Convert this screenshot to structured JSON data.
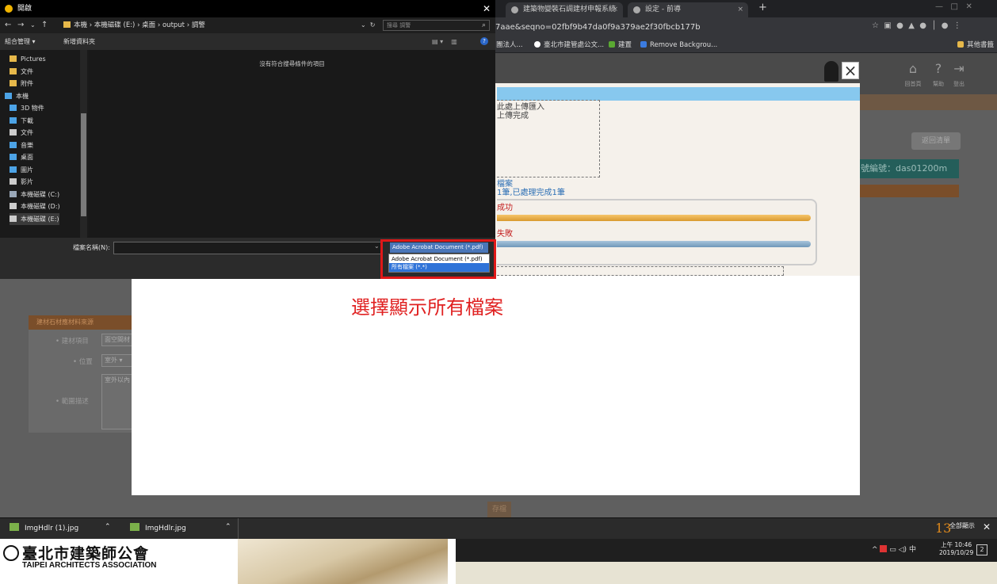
{
  "browser": {
    "tabs": [
      {
        "label": "建築物變裝石調建材申報系統"
      },
      {
        "label": "設定 - 前導"
      }
    ],
    "new_tab": "+",
    "url": "7aae&seqno=02fbf9b47da0f9a379ae2f30fbcb177b",
    "bookmarks": [
      "團法人...",
      "臺北市建管處公文...",
      "建置",
      "Remove Backgrou..."
    ],
    "other_bookmarks": "其他書籤"
  },
  "dialog": {
    "title": "開啟",
    "breadcrumb": "本機 › 本機磁碟 (E:) › 桌面 › output › 調警",
    "search_placeholder": "搜尋 調警",
    "toolbar_organize": "組合管理 ▾",
    "toolbar_newfolder": "新增資料夾",
    "tree": [
      {
        "label": "Pictures",
        "color": "#e6b84a"
      },
      {
        "label": "文件",
        "color": "#e6b84a"
      },
      {
        "label": "附件",
        "color": "#e6b84a"
      },
      {
        "label": "本機",
        "color": "#4ca3e6"
      },
      {
        "label": "3D 物件",
        "color": "#4ca3e6"
      },
      {
        "label": "下載",
        "color": "#4ca3e6"
      },
      {
        "label": "文件",
        "color": "#cccccc"
      },
      {
        "label": "音樂",
        "color": "#4ca3e6"
      },
      {
        "label": "桌面",
        "color": "#4ca3e6"
      },
      {
        "label": "圖片",
        "color": "#4ca3e6"
      },
      {
        "label": "影片",
        "color": "#cccccc"
      },
      {
        "label": "本機磁碟 (C:)",
        "color": "#9aa8b8"
      },
      {
        "label": "本機磁碟 (D:)",
        "color": "#cccccc"
      },
      {
        "label": "本機磁碟 (E:)",
        "color": "#cccccc"
      }
    ],
    "empty_message": "沒有符合搜尋條件的項目",
    "filename_label": "檔案名稱(N):",
    "filetype_selected": "Adobe Acrobat Document (*.pdf)",
    "filetype_options": [
      "Adobe Acrobat Document (*.pdf)",
      "所有檔案 (*.*)"
    ]
  },
  "modal": {
    "close": "×",
    "upload_line1": "此處上傳匯入",
    "upload_line2": "上傳完成",
    "files_label": "檔案",
    "files_status": "1筆,已處理完成1筆",
    "success_label": "成功",
    "fail_label": "失敗",
    "success_progress": 1.0,
    "fail_progress": 1.0
  },
  "annotation": "選擇顯示所有檔案",
  "page": {
    "header_labels": [
      "回首頁",
      "幫助",
      "登出"
    ],
    "back_button": "返回清單",
    "serial_label": "號編號：das01200m",
    "form_title": "建材石材應材料來源",
    "form_fields": [
      "• 建材項目",
      "• 位置",
      "• 範圍描述"
    ],
    "field_values": [
      "面空間材",
      "室外 ▾",
      "室外以內"
    ],
    "bottom_button": "存檔"
  },
  "downloads": {
    "items": [
      "ImgHdlr (1).jpg",
      "ImgHdlr.jpg"
    ],
    "show_all": "全部顯示",
    "slide_number": "13"
  },
  "taskbar": {
    "ime": "中",
    "time": "上午 10:46",
    "date": "2019/10/29",
    "notifications": "2"
  },
  "footer": {
    "org_zh": "臺北市建築師公會",
    "org_en": "TAIPEI ARCHITECTS ASSOCIATION"
  }
}
